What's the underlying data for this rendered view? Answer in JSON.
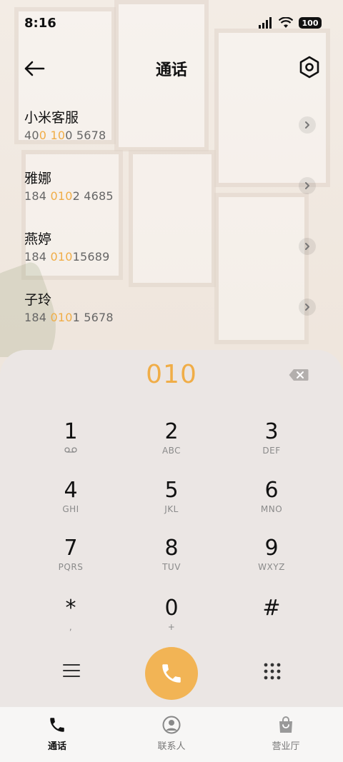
{
  "status": {
    "time": "8:16",
    "battery": "100"
  },
  "header": {
    "title": "通话"
  },
  "contacts": [
    {
      "name": "小米客服",
      "num_pre": "40",
      "num_hl1": "0",
      "num_mid": " ",
      "num_hl2": "10",
      "num_post": "0 5678"
    },
    {
      "name": "雅娜",
      "num_pre": "184 ",
      "num_hl1": "010",
      "num_mid": "",
      "num_hl2": "",
      "num_post": "2 4685"
    },
    {
      "name": "燕婷",
      "num_pre": "184 ",
      "num_hl1": "010",
      "num_mid": "",
      "num_hl2": "",
      "num_post": "15689"
    },
    {
      "name": "子玲",
      "num_pre": "184 ",
      "num_hl1": "010",
      "num_mid": "",
      "num_hl2": "",
      "num_post": "1 5678"
    }
  ],
  "dialer": {
    "input": "010",
    "keys": [
      {
        "digit": "1",
        "sub": ""
      },
      {
        "digit": "2",
        "sub": "ABC"
      },
      {
        "digit": "3",
        "sub": "DEF"
      },
      {
        "digit": "4",
        "sub": "GHI"
      },
      {
        "digit": "5",
        "sub": "JKL"
      },
      {
        "digit": "6",
        "sub": "MNO"
      },
      {
        "digit": "7",
        "sub": "PQRS"
      },
      {
        "digit": "8",
        "sub": "TUV"
      },
      {
        "digit": "9",
        "sub": "WXYZ"
      },
      {
        "digit": "*",
        "sub": ","
      },
      {
        "digit": "0",
        "sub": "+"
      },
      {
        "digit": "#",
        "sub": ""
      }
    ]
  },
  "nav": [
    {
      "label": "通话",
      "icon": "phone-icon",
      "active": true
    },
    {
      "label": "联系人",
      "icon": "contacts-icon",
      "active": false
    },
    {
      "label": "营业厅",
      "icon": "store-bag-icon",
      "active": false
    }
  ],
  "colors": {
    "accent": "#f0ad47",
    "call_button": "#f2b455",
    "dialer_bg": "#ebe6e4"
  }
}
